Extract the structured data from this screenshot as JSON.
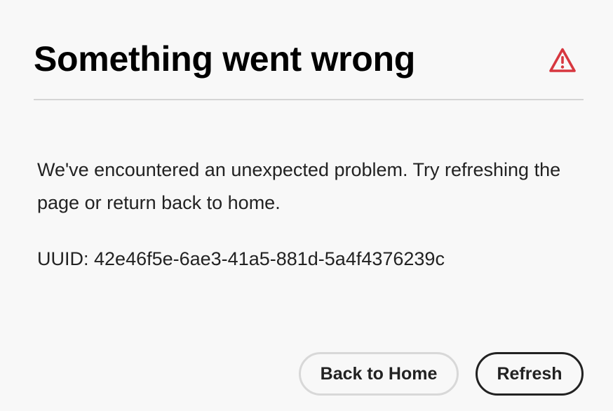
{
  "dialog": {
    "title": "Something went wrong",
    "icon": "alert-triangle-icon",
    "message": "We've encountered an unexpected problem. Try refreshing the page or return back to home.",
    "uuid_label": "UUID:",
    "uuid_value": "42e46f5e-6ae3-41a5-881d-5a4f4376239c",
    "buttons": {
      "back_home_label": "Back to Home",
      "refresh_label": "Refresh"
    }
  },
  "colors": {
    "background": "#f8f8f8",
    "alert": "#d7373f",
    "text": "#222222",
    "divider": "#d5d5d5",
    "secondary_border": "#d8d8d8"
  }
}
